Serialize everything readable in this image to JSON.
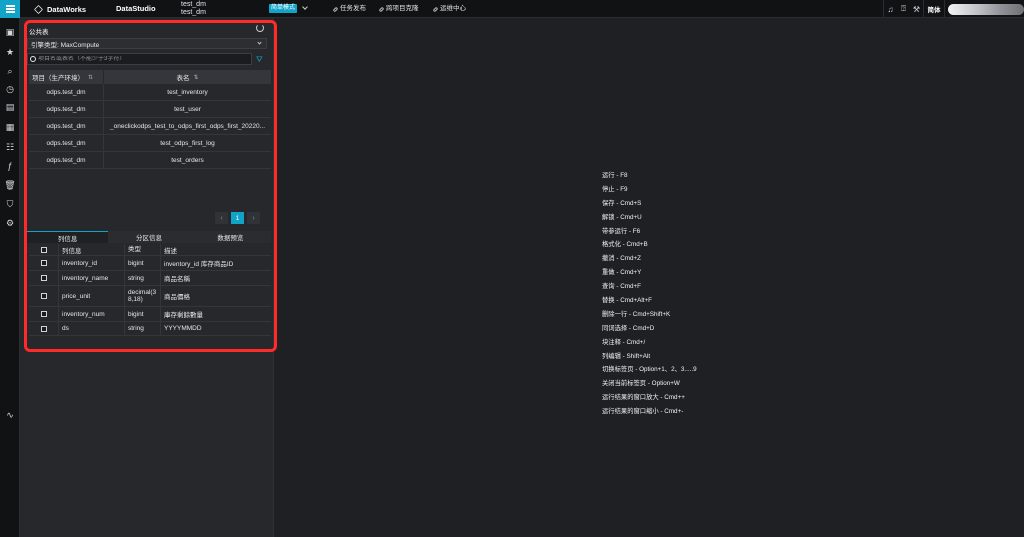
{
  "topbar": {
    "brand": "DataWorks",
    "studio": "DataStudio",
    "project_line1": "test_dm",
    "project_line2": "test_dm",
    "mode_badge": "简单模式",
    "nav_links": [
      "任务发布",
      "跨项目克隆",
      "运维中心"
    ],
    "language": "简体"
  },
  "panel": {
    "title": "公共表",
    "engine_select": "引擎类型: MaxCompute",
    "search_placeholder": "项目名或表名（不能少于3字符）",
    "table_headers": {
      "project": "项目（生产环境）",
      "name": "表名"
    },
    "rows": [
      {
        "project": "odps.test_dm",
        "name": "test_inventory"
      },
      {
        "project": "odps.test_dm",
        "name": "test_user"
      },
      {
        "project": "odps.test_dm",
        "name": "_oneclickodps_test_to_odps_first_odps_first_20220..."
      },
      {
        "project": "odps.test_dm",
        "name": "test_odps_first_log"
      },
      {
        "project": "odps.test_dm",
        "name": "test_orders"
      }
    ],
    "pagination": {
      "current": "1"
    }
  },
  "detail": {
    "tabs": [
      "列信息",
      "分区信息",
      "数据预览"
    ],
    "headers": {
      "col": "列信息",
      "type": "类型",
      "desc": "描述"
    },
    "rows": [
      {
        "col": "inventory_id",
        "type": "bigint",
        "desc": "inventory_id 库存商品ID"
      },
      {
        "col": "inventory_name",
        "type": "string",
        "desc": "商品名稱"
      },
      {
        "col": "price_unit",
        "type": "decimal(38,18)",
        "desc": "商品價格"
      },
      {
        "col": "inventory_num",
        "type": "bigint",
        "desc": "庫存剩餘數量"
      },
      {
        "col": "ds",
        "type": "string",
        "desc": "YYYYMMDD"
      }
    ]
  },
  "shortcuts": [
    "运行 - F8",
    "停止 - F9",
    "保存 - Cmd+S",
    "解锁 - Cmd+U",
    "带参运行 - F6",
    "格式化 - Cmd+B",
    "撤消 - Cmd+Z",
    "重做 - Cmd+Y",
    "查询 - Cmd+F",
    "替换 - Cmd+Alt+F",
    "删除一行 - Cmd+Shift+K",
    "同词选择 - Cmd+D",
    "块注释 - Cmd+/",
    "列编辑 - Shift+Alt",
    "切换标签页 - Option+1、2、3.....9",
    "关闭当前标签页 - Option+W",
    "运行结果的窗口放大 - Cmd++",
    "运行结果的窗口缩小 - Cmd+-"
  ],
  "colors": {
    "accent": "#12a4c8",
    "highlight": "#ff2a2a"
  }
}
